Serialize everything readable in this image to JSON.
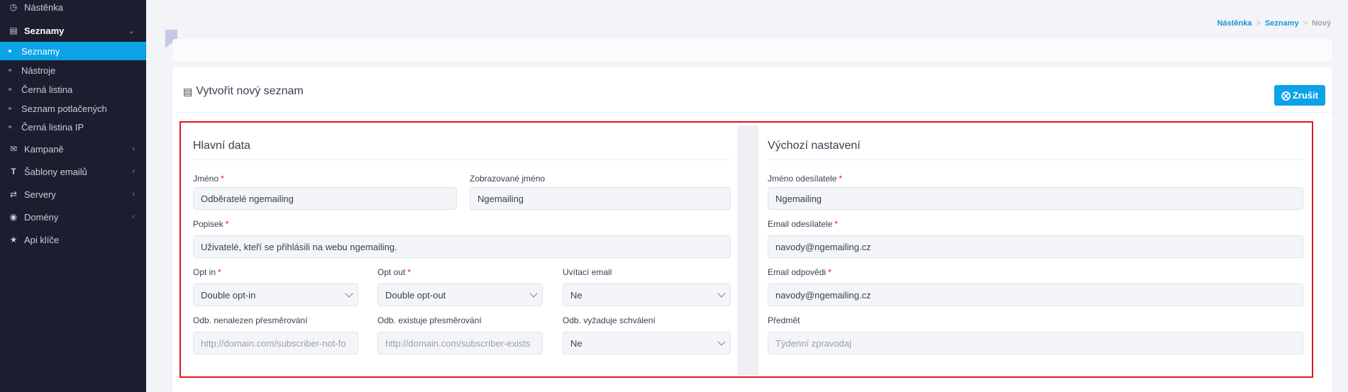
{
  "sidebar": {
    "dashboard": "Nástěnka",
    "lists_group": "Seznamy",
    "sub_items": [
      "Seznamy",
      "Nástroje",
      "Černá listina",
      "Seznam potlačených",
      "Černá listina IP"
    ],
    "campaigns": "Kampaně",
    "templates": "Šablony emailů",
    "servers": "Servery",
    "domains": "Domény",
    "api_keys": "Api klíče"
  },
  "breadcrumb": {
    "home": "Nástěnka",
    "lists": "Seznamy",
    "current": "Nový",
    "separator": ">"
  },
  "card": {
    "title": "Vytvořit nový seznam",
    "cancel_label": "Zrušit"
  },
  "main_data": {
    "title": "Hlavní data",
    "name_label": "Jméno",
    "name_value": "Odběratelé ngemailing",
    "display_name_label": "Zobrazované jméno",
    "display_name_value": "Ngemailing",
    "description_label": "Popisek",
    "description_value": "Uživatelé, kteří se přihlásili na webu ngemailing.",
    "optin_label": "Opt in",
    "optin_value": "Double opt-in",
    "optout_label": "Opt out",
    "optout_value": "Double opt-out",
    "welcome_label": "Uvítací email",
    "welcome_value": "Ne",
    "notfound_label": "Odb. nenalezen přesměrování",
    "notfound_placeholder": "http://domain.com/subscriber-not-fo",
    "exists_label": "Odb. existuje přesměrování",
    "exists_placeholder": "http://domain.com/subscriber-exists",
    "approval_label": "Odb. vyžaduje schválení",
    "approval_value": "Ne",
    "required_mark": "*"
  },
  "defaults": {
    "title": "Výchozí nastavení",
    "sender_name_label": "Jméno odesílatele",
    "sender_name_value": "Ngemailing",
    "sender_email_label": "Email odesílatele",
    "sender_email_value": "navody@ngemailing.cz",
    "reply_email_label": "Email odpovědi",
    "reply_email_value": "navody@ngemailing.cz",
    "subject_label": "Předmět",
    "subject_placeholder": "Týdenní zpravodaj"
  },
  "colors": {
    "accent": "#0aa3e8",
    "sidebar_bg": "#1b1e2e",
    "highlight": "#e3141b"
  }
}
